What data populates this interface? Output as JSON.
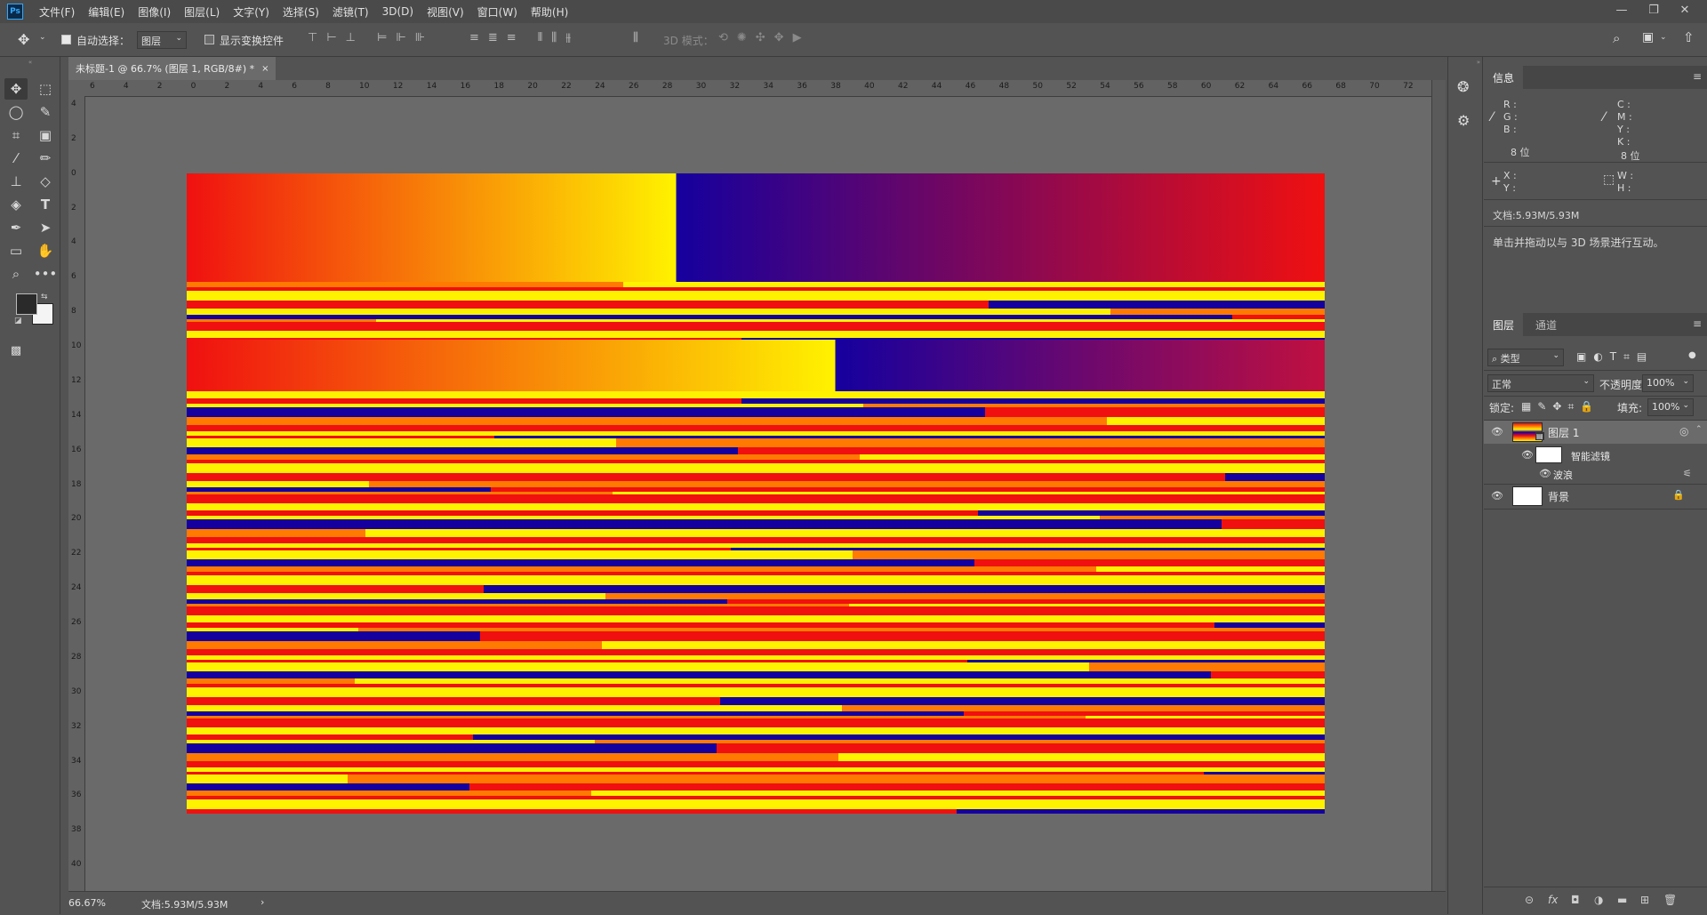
{
  "app": {
    "logo": "Ps",
    "menu": [
      "文件(F)",
      "编辑(E)",
      "图像(I)",
      "图层(L)",
      "文字(Y)",
      "选择(S)",
      "滤镜(T)",
      "3D(D)",
      "视图(V)",
      "窗口(W)",
      "帮助(H)"
    ],
    "window_controls": [
      "—",
      "❐",
      "✕"
    ]
  },
  "options_bar": {
    "auto_select_label": "自动选择：",
    "auto_select_checked": true,
    "auto_select_target": "图层",
    "show_transform_label": "显示变换控件",
    "show_transform_checked": false,
    "mode_3d_label": "3D 模式："
  },
  "document": {
    "tab_title": "未标题-1 @ 66.7% (图层 1, RGB/8#) *",
    "tab_close": "×",
    "zoom": "66.67%",
    "doc_size": "文档:5.93M/5.93M",
    "ruler_top_labels": [
      "6",
      "4",
      "2",
      "0",
      "2",
      "4",
      "6",
      "8",
      "10",
      "12",
      "14",
      "16",
      "18",
      "20",
      "22",
      "24",
      "26",
      "28",
      "30",
      "32",
      "34",
      "36",
      "38",
      "40",
      "42",
      "44",
      "46",
      "48",
      "50",
      "52",
      "54",
      "56",
      "58",
      "60",
      "62",
      "64",
      "66",
      "68",
      "70",
      "72"
    ],
    "ruler_left_labels": [
      "4",
      "2",
      "0",
      "2",
      "4",
      "6",
      "8",
      "10",
      "12",
      "14",
      "16",
      "18",
      "20",
      "22",
      "24",
      "26",
      "28",
      "30",
      "32",
      "34",
      "36",
      "38",
      "40"
    ],
    "image_colors": {
      "red": "#f01010",
      "yellow": "#fff200",
      "blue": "#15009e",
      "orange": "#ff7a00"
    }
  },
  "info_panel": {
    "tab": "信息",
    "r_label": "R :",
    "g_label": "G :",
    "b_label": "B :",
    "c_label": "C :",
    "m_label": "M :",
    "y_label": "Y :",
    "k_label": "K :",
    "bit_left": "8 位",
    "bit_right": "8 位",
    "x_label": "X :",
    "y2_label": "Y :",
    "w_label": "W :",
    "h_label": "H :",
    "doc_size": "文档:5.93M/5.93M",
    "hint": "单击并拖动以与 3D 场景进行互动。"
  },
  "layers_panel": {
    "tabs": [
      "图层",
      "通道"
    ],
    "filter_label": "类型",
    "blend_mode": "正常",
    "opacity_label": "不透明度:",
    "opacity_value": "100%",
    "lock_label": "锁定:",
    "fill_label": "填充:",
    "fill_value": "100%",
    "layers": [
      {
        "name": "图层 1",
        "selected": true
      },
      {
        "name": "智能滤镜"
      },
      {
        "name": "波浪"
      },
      {
        "name": "背景",
        "locked": true
      }
    ],
    "footer_icons": [
      "link-icon",
      "fx-icon",
      "mask-icon",
      "adjustment-icon",
      "group-icon",
      "new-layer-icon",
      "trash-icon"
    ],
    "footer_labels": [
      "⊝",
      "fx",
      "◘",
      "◑",
      "▬",
      "⊞",
      "🗑"
    ]
  }
}
